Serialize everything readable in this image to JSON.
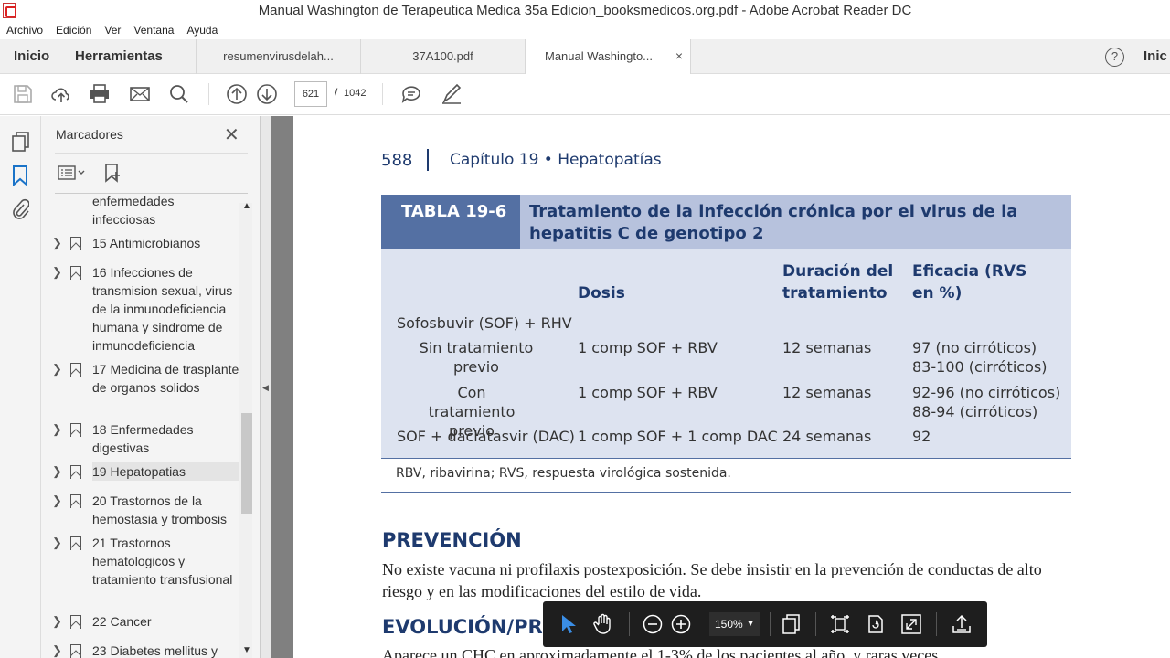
{
  "window": {
    "title": "Manual Washington de Terapeutica Medica 35a Edicion_booksmedicos.org.pdf - Adobe Acrobat Reader DC"
  },
  "menu": [
    "Archivo",
    "Edición",
    "Ver",
    "Ventana",
    "Ayuda"
  ],
  "nav": {
    "home": "Inicio",
    "tools": "Herramientas",
    "right_link": "Inic"
  },
  "tabs": [
    {
      "label": "resumenvirusdelah..."
    },
    {
      "label": "37A100.pdf"
    },
    {
      "label": "Manual Washingto...",
      "close": "×"
    }
  ],
  "toolbar": {
    "page_current": "621",
    "page_sep": "/",
    "page_total": "1042"
  },
  "bookmarks_panel": {
    "title": "Marcadores",
    "items": [
      {
        "text": "enfermedades infecciosas"
      },
      {
        "text": "15 Antimicrobianos"
      },
      {
        "text": "16 Infecciones de transmision sexual, virus de la inmunodeficiencia humana y sindrome de inmunodeficiencia"
      },
      {
        "text": "17 Medicina de trasplante de organos solidos"
      },
      {
        "text": "18 Enfermedades digestivas"
      },
      {
        "text": "19 Hepatopatias"
      },
      {
        "text": "20 Trastornos de la hemostasia y trombosis"
      },
      {
        "text": "21 Trastornos hematologicos y tratamiento transfusional"
      },
      {
        "text": "22 Cancer"
      },
      {
        "text": "23 Diabetes mellitus y"
      }
    ]
  },
  "document": {
    "page_number": "588",
    "chapter": "Capítulo 19 • Hepatopatías",
    "table": {
      "label": "TABLA 19-6",
      "title": "Tratamiento de la infección crónica por el virus de la hepatitis C de genotipo 2",
      "headers": [
        "Dosis",
        "Duración del tratamiento",
        "Eficacia (RVS en %)"
      ],
      "rows": [
        {
          "regimen": "Sofosbuvir (SOF) + RHV",
          "dose": "",
          "duration": "",
          "efficacy": ""
        },
        {
          "regimen": "Sin tratamiento previo",
          "dose": "1 comp SOF + RBV",
          "duration": "12 semanas",
          "efficacy": "97 (no cirróticos)\n83-100 (cirróticos)"
        },
        {
          "regimen": "Con tratamiento previo",
          "dose": "1 comp SOF + RBV",
          "duration": "12 semanas",
          "efficacy": "92-96 (no cirróticos)\n88-94 (cirróticos)"
        },
        {
          "regimen": "SOF + daclatasvir (DAC)",
          "dose": "1 comp SOF + 1 comp DAC",
          "duration": "24 semanas",
          "efficacy": "92"
        }
      ],
      "footnote": "RBV, ribavirina; RVS, respuesta virológica sostenida."
    },
    "section1": {
      "heading": "PREVENCIÓN",
      "text": "No existe vacuna ni profilaxis postexposición. Se debe insistir en la prevención de conductas de alto riesgo y en las modificaciones del estilo de vida."
    },
    "section2": {
      "heading": "EVOLUCIÓN/PRO",
      "text": "Aparece un CHC en aproximadamente el 1-3% de los pacientes al año, y raras veces"
    }
  },
  "floating_toolbar": {
    "zoom": "150%"
  }
}
